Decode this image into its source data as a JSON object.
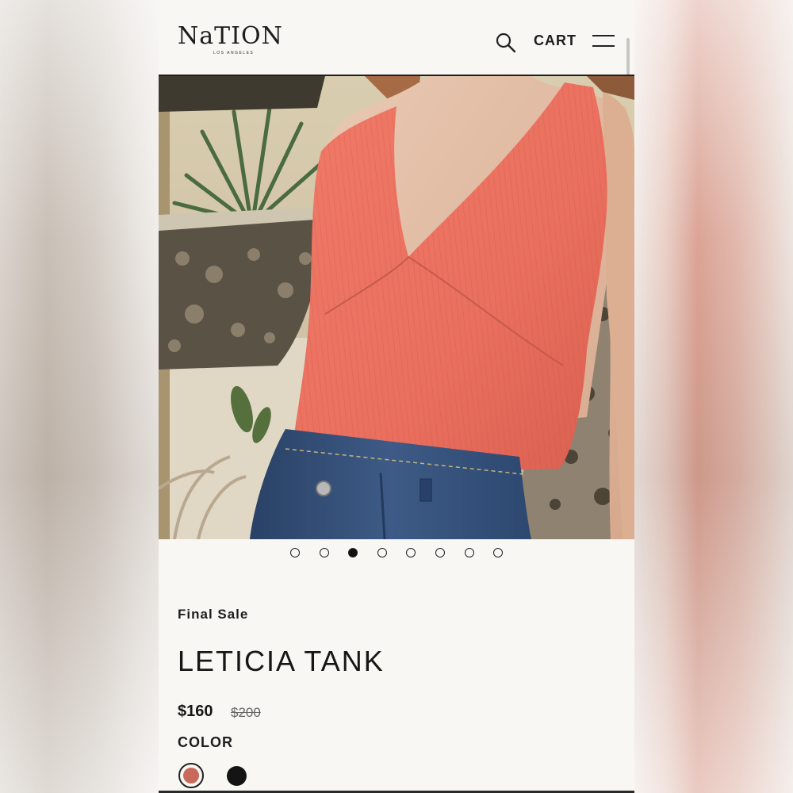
{
  "brand": {
    "logo_text": "NaTION",
    "logo_subtext": "LOS ANGELES"
  },
  "header": {
    "cart_label": "CART",
    "icons": [
      "search-icon",
      "menu-icon"
    ]
  },
  "gallery": {
    "slide_count": 8,
    "active_slide": 3
  },
  "product": {
    "sale_label": "Final Sale",
    "title": "LETICIA TANK",
    "price": "$160",
    "compare_price": "$200",
    "color_label": "COLOR",
    "colors": [
      {
        "name": "coral",
        "hex": "#c8695b",
        "selected": true
      },
      {
        "name": "black",
        "hex": "#141414",
        "selected": false
      }
    ]
  },
  "colors": {
    "background": "#f8f7f4",
    "text": "#161616",
    "tank": "#ec7463",
    "denim": "#334f78"
  }
}
